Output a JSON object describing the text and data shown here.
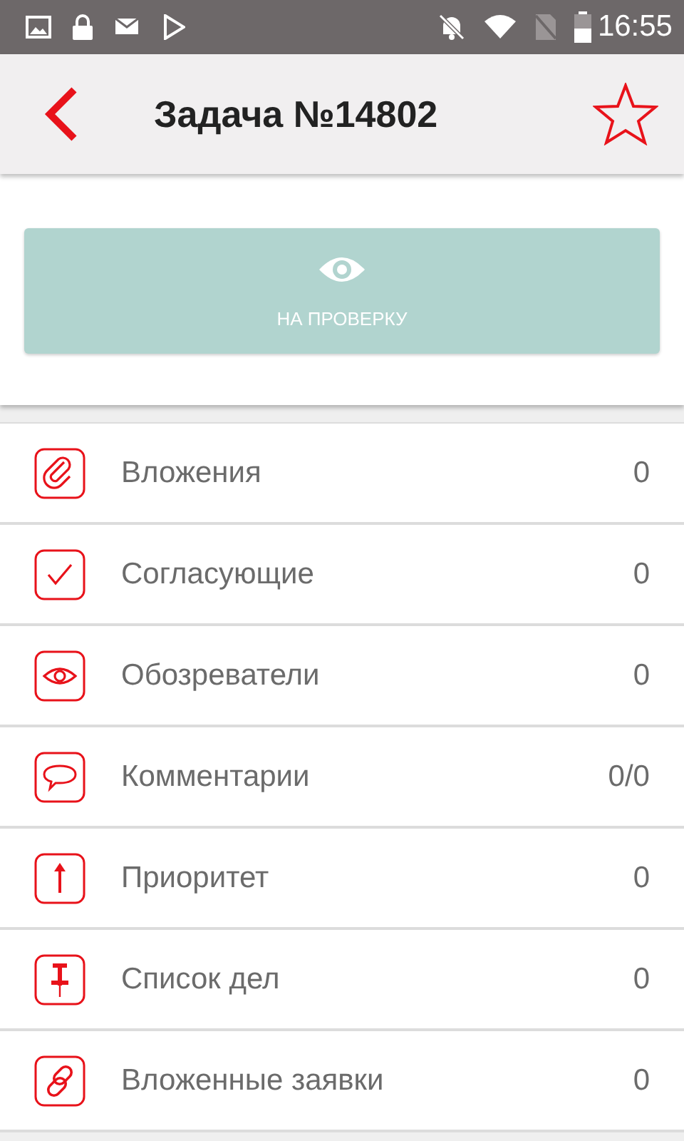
{
  "status_bar": {
    "time": "16:55"
  },
  "toolbar": {
    "title": "Задача №14802",
    "starred": false
  },
  "action_button": {
    "label": "НА ПРОВЕРКУ",
    "disabled": true
  },
  "items": [
    {
      "label": "Вложения",
      "count": "0"
    },
    {
      "label": "Согласующие",
      "count": "0"
    },
    {
      "label": "Обозреватели",
      "count": "0"
    },
    {
      "label": "Комментарии",
      "count": "0/0"
    },
    {
      "label": "Приоритет",
      "count": "0"
    },
    {
      "label": "Список дел",
      "count": "0"
    },
    {
      "label": "Вложенные заявки",
      "count": "0"
    }
  ]
}
